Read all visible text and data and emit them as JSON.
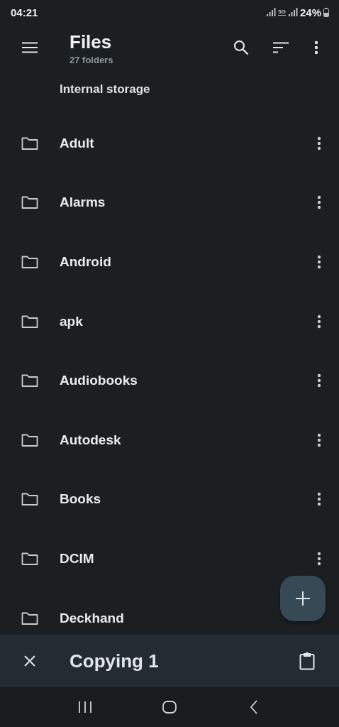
{
  "status_bar": {
    "time": "04:21",
    "network": "5G",
    "battery": "24%"
  },
  "app_bar": {
    "title": "Files",
    "subtitle": "27 folders"
  },
  "location": "Internal storage",
  "folders": [
    {
      "name": "Adult"
    },
    {
      "name": "Alarms"
    },
    {
      "name": "Android"
    },
    {
      "name": "apk"
    },
    {
      "name": "Audiobooks"
    },
    {
      "name": "Autodesk"
    },
    {
      "name": "Books"
    },
    {
      "name": "DCIM"
    },
    {
      "name": "Deckhand"
    }
  ],
  "copy_bar": {
    "label": "Copying 1"
  }
}
